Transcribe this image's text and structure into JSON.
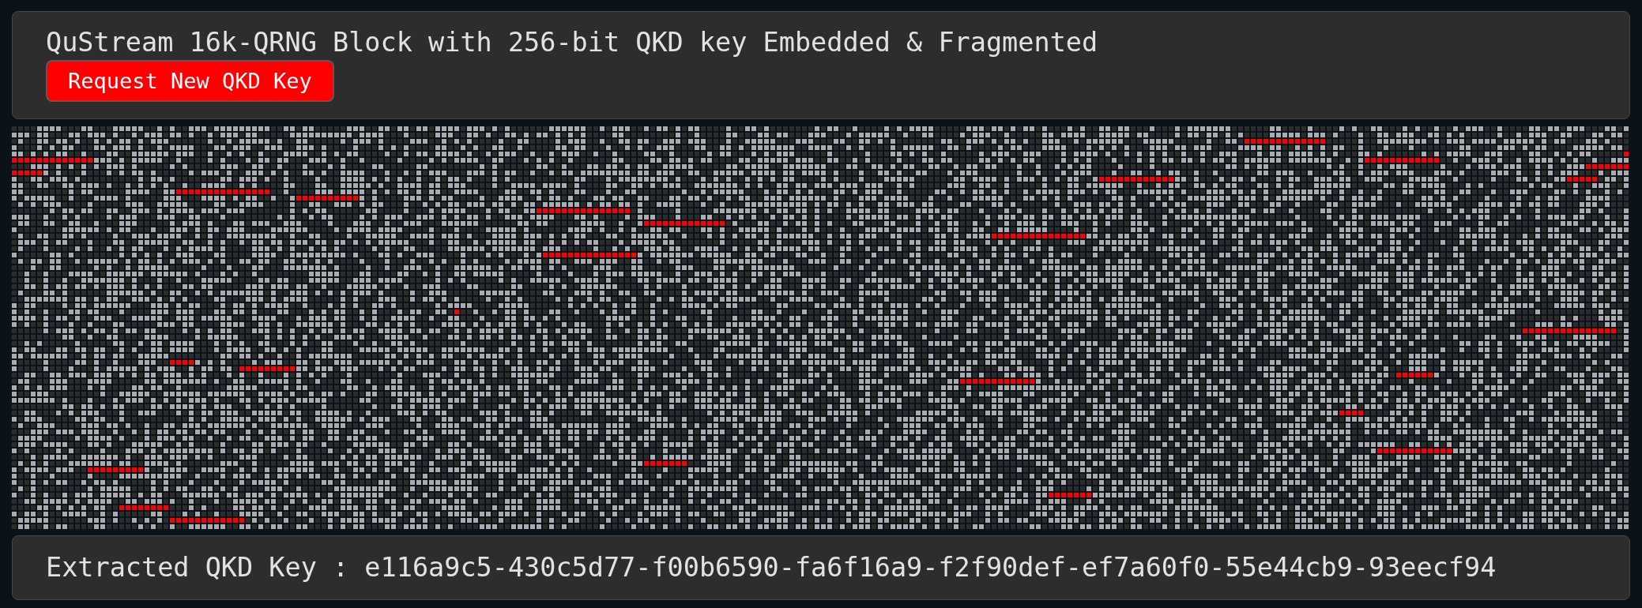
{
  "header": {
    "title": "QuStream 16k-QRNG Block with 256-bit QKD key Embedded & Fragmented",
    "button": "Request New QKD Key"
  },
  "bit_grid": {
    "key_highlighted": true
  },
  "footer": {
    "text": "Extracted QKD Key : e116a9c5-430c5d77-f00b6590-fa6f16a9-f2f90def-ef7a60f0-55e44cb9-93eecf94"
  }
}
